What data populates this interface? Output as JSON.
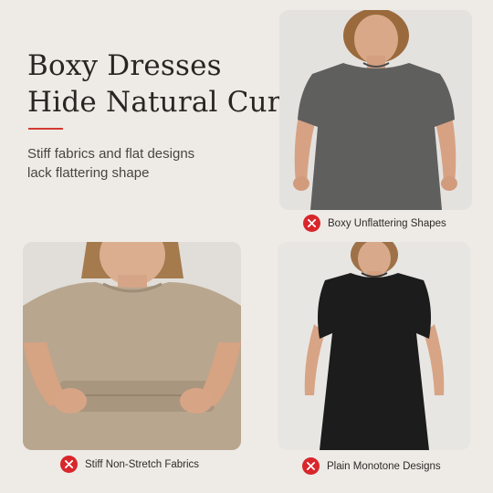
{
  "headline": {
    "line1": "Boxy Dresses",
    "line2": "Hide Natural Curves"
  },
  "subtext": {
    "line1": "Stiff fabrics and flat designs",
    "line2": "lack flattering shape"
  },
  "captions": [
    {
      "label": "Boxy Unflattering Shapes",
      "icon": "x-icon"
    },
    {
      "label": "Stiff Non-Stretch Fabrics",
      "icon": "x-icon"
    },
    {
      "label": "Plain Monotone Designs",
      "icon": "x-icon"
    }
  ],
  "colors": {
    "background": "#eeebe7",
    "accent": "#d33a2f",
    "icon_red": "#d8262b",
    "gray_dress": "#5e5e5d",
    "beige_top": "#b7a48e",
    "black_dress": "#1c1b1b"
  }
}
